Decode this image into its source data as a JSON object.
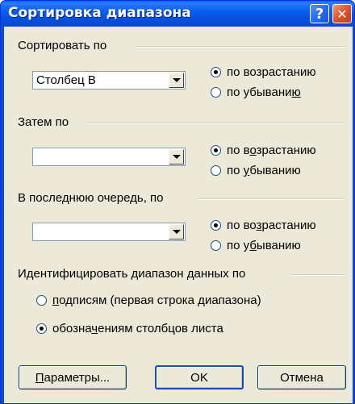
{
  "window": {
    "title": "Сортировка диапазона",
    "help_label": "?",
    "close_label": "✕"
  },
  "sort_by": {
    "label": "Сортировать по",
    "column": "Столбец B",
    "ascending": {
      "label": "по возрастанию",
      "checked": true
    },
    "descending": {
      "label_pre": "по убывани",
      "label_key": "ю",
      "label_post": "",
      "checked": false
    }
  },
  "then_by": {
    "label": "Затем по",
    "column": "",
    "ascending": {
      "label_pre": "по в",
      "label_key": "о",
      "label_post": "зрастанию",
      "checked": true
    },
    "descending": {
      "label_pre": "по ",
      "label_key": "у",
      "label_post": "быванию",
      "checked": false
    }
  },
  "last_by": {
    "label": "В последнюю очередь, по",
    "column": "",
    "ascending": {
      "label_pre": "по во",
      "label_key": "з",
      "label_post": "растанию",
      "checked": true
    },
    "descending": {
      "label_pre": "по у",
      "label_key": "б",
      "label_post": "ыванию",
      "checked": false
    }
  },
  "identify": {
    "label": "Идентифицировать диапазон данных по",
    "by_labels": {
      "label_pre": "",
      "label_key": "п",
      "label_post": "одписям (первая строка диапазона)",
      "checked": false
    },
    "by_column_names": {
      "label_pre": "обозна",
      "label_key": "ч",
      "label_post": "ениям столбцов листа",
      "checked": true
    }
  },
  "buttons": {
    "options": {
      "label_pre": "",
      "label_key": "П",
      "label_post": "араметры..."
    },
    "ok": "OK",
    "cancel": "Отмена"
  }
}
